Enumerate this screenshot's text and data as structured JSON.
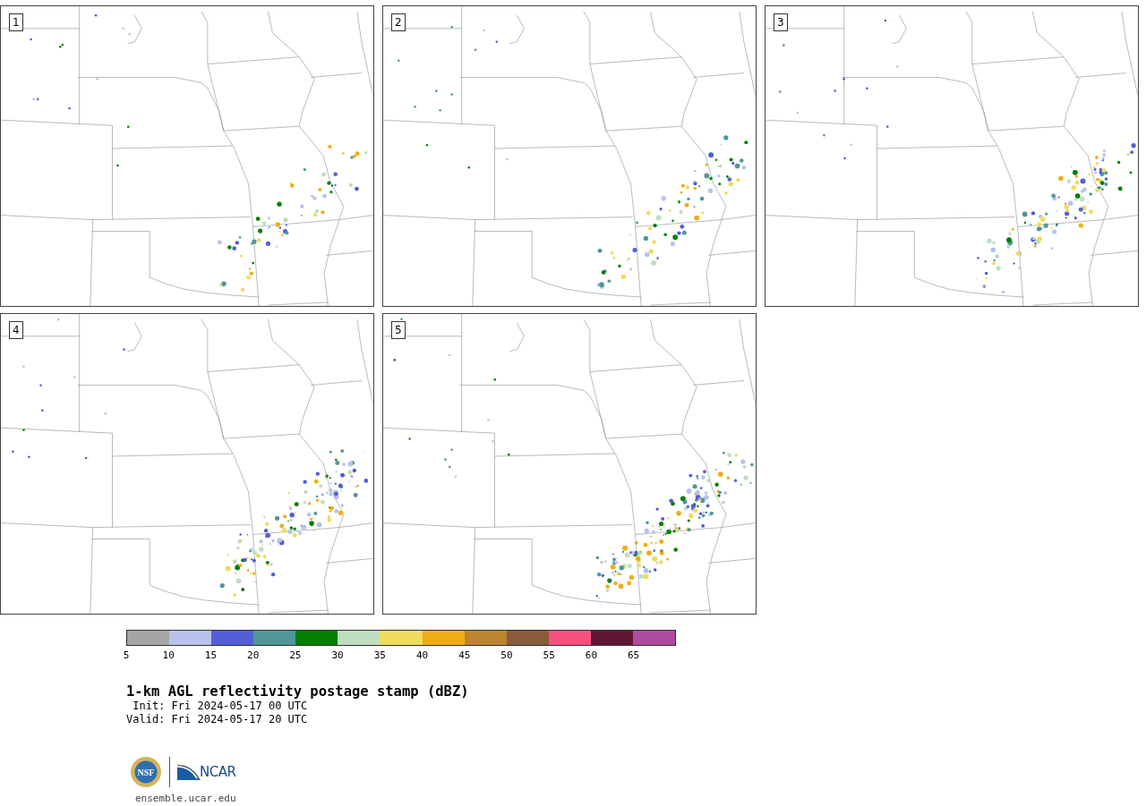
{
  "panels": [
    {
      "label": "1"
    },
    {
      "label": "2"
    },
    {
      "label": "3"
    },
    {
      "label": "4"
    },
    {
      "label": "5"
    }
  ],
  "colorbar": {
    "segments": [
      {
        "color": "#a5a5a5"
      },
      {
        "color": "#b7c2ec"
      },
      {
        "color": "#525fd6"
      },
      {
        "color": "#50969a"
      },
      {
        "color": "#008000"
      },
      {
        "color": "#bfdec0"
      },
      {
        "color": "#f0dc5e"
      },
      {
        "color": "#f0ac16"
      },
      {
        "color": "#bd842f"
      },
      {
        "color": "#8b5a3c"
      },
      {
        "color": "#f6507f"
      },
      {
        "color": "#5f1633"
      },
      {
        "color": "#ae4aa1"
      }
    ],
    "ticks": [
      "5",
      "10",
      "15",
      "20",
      "25",
      "30",
      "35",
      "40",
      "45",
      "50",
      "55",
      "60",
      "65"
    ]
  },
  "title": "1-km AGL reflectivity postage stamp (dBZ)",
  "init": " Init: Fri 2024-05-17 00 UTC",
  "valid": "Valid: Fri 2024-05-17 20 UTC",
  "logos": {
    "nsf": "NSF",
    "ncar": "NCAR"
  },
  "footer": "ensemble.ucar.edu"
}
